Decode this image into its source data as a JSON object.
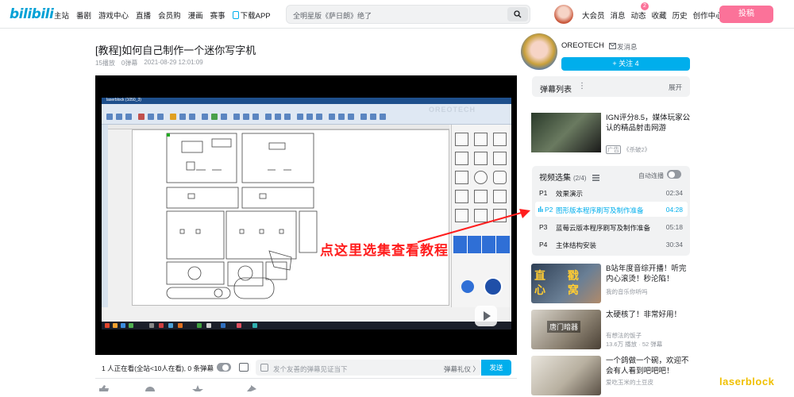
{
  "header": {
    "logo": "bilibili",
    "nav": [
      "主站",
      "番剧",
      "游戏中心",
      "直播",
      "会员购",
      "漫画",
      "赛事"
    ],
    "download_label": "下载APP",
    "search_placeholder": "全明星版《萨日朗》绝了",
    "right_nav": [
      "大会员",
      "消息",
      "动态",
      "收藏",
      "历史",
      "创作中心"
    ],
    "dynamic_badge": "2",
    "upload_label": "投稿"
  },
  "video": {
    "title": "[教程]如何自己制作一个迷你写字机",
    "plays": "15播放",
    "danmaku": "0弹幕",
    "date": "2021-08-29 12:01:09"
  },
  "player": {
    "overlay_text": "点这里选集查看教程",
    "screen_title": "laserblock (1050_3)",
    "screen_brand": "OREOTECH",
    "viewers": "1 人正在看(全站<10人在看), 0 条弹幕",
    "danmaku_placeholder": "发个友善的弹幕见证当下",
    "etiquette": "弹幕礼仪 〉",
    "send_label": "发送"
  },
  "uploader": {
    "name": "OREOTECH",
    "message_label": "发消息",
    "follow_label": "+ 关注 4"
  },
  "danmaku_list": {
    "title": "弹幕列表",
    "expand": "展开"
  },
  "ad": {
    "title": "IGN评分8.5，媒体玩家公认的精品射击网游",
    "tag": "广告",
    "source": "《杀破2》"
  },
  "collection": {
    "title": "视频选集",
    "count": "(2/4)",
    "autoplay_label": "自动连播",
    "episodes": [
      {
        "num": "P1",
        "title": "效果演示",
        "duration": "02:34"
      },
      {
        "num": "P2",
        "title": "图形版本程序刷写及制作准备",
        "duration": "04:28"
      },
      {
        "num": "P3",
        "title": "蓝莓云版本程序刷写及制作准备",
        "duration": "05:18"
      },
      {
        "num": "P4",
        "title": "主体结构安装",
        "duration": "30:34"
      }
    ]
  },
  "recommendations": [
    {
      "title": "B站年度音综开播！听完内心滚烫！秒沦陷！",
      "author": "我的音乐你听吗",
      "stats": "",
      "overlay": "直 戳 心 窝"
    },
    {
      "title": "太硬核了！非常好用！",
      "author": "有想法的饭子",
      "stats": "13.6万 播放 · 52 弹幕",
      "overlay": "唐门暗器"
    },
    {
      "title": "一个鸽做一个碗，欢迎不会有人看到吧吧吧！",
      "author": "爱吃玉米的土豆皮",
      "stats": "",
      "overlay": ""
    }
  ],
  "watermark": "laserblock",
  "colors": {
    "accent": "#00aeec",
    "brand_pink": "#fb7299",
    "overlay_red": "#ff1d1d"
  }
}
